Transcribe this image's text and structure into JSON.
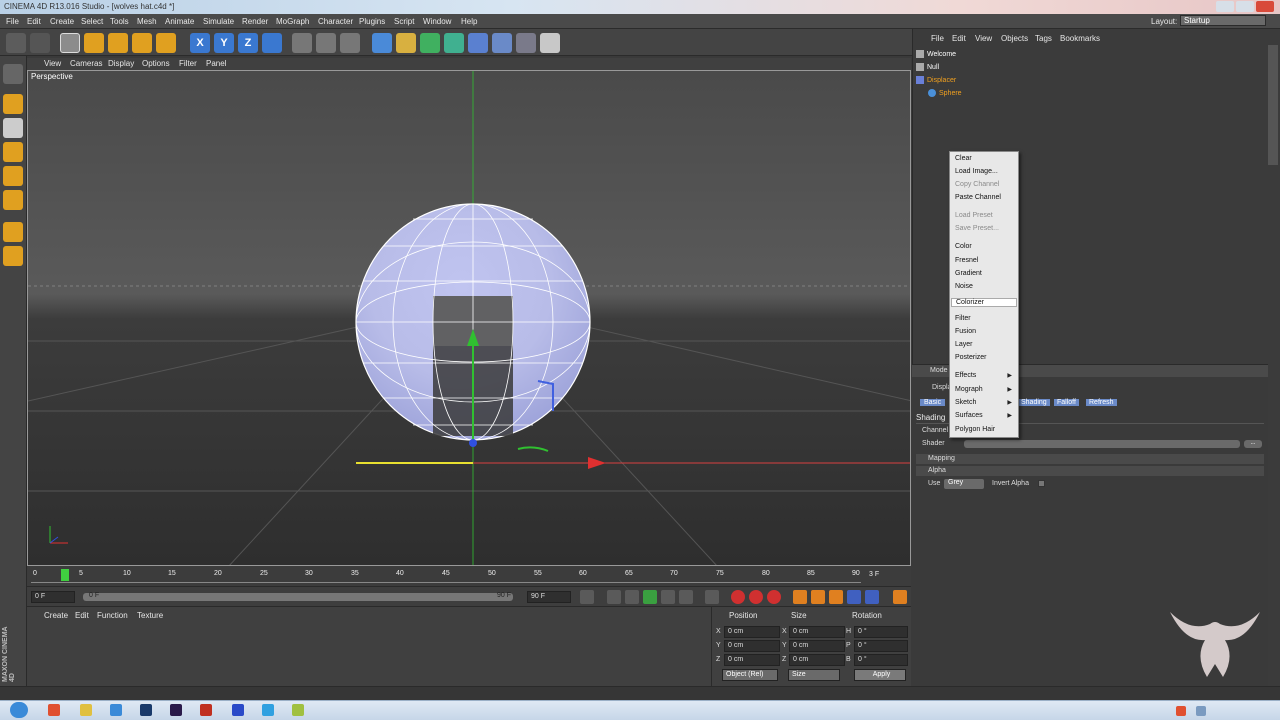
{
  "window": {
    "title": "CINEMA 4D R13.016 Studio - [wolves hat.c4d *]"
  },
  "menubar": [
    "File",
    "Edit",
    "Create",
    "Select",
    "Tools",
    "Mesh",
    "Animate",
    "Simulate",
    "Render",
    "MoGraph",
    "Character",
    "Plugins",
    "Script",
    "Window",
    "Help"
  ],
  "layout": {
    "label": "Layout:",
    "value": "Startup"
  },
  "viewport": {
    "menu": [
      "View",
      "Cameras",
      "Display",
      "Options",
      "Filter",
      "Panel"
    ],
    "camera_label": "Perspective"
  },
  "toolbar": {
    "axis_x": "X",
    "axis_y": "Y",
    "axis_z": "Z"
  },
  "timeline": {
    "ticks": [
      "0",
      "5",
      "10",
      "15",
      "20",
      "25",
      "30",
      "35",
      "40",
      "45",
      "50",
      "55",
      "60",
      "65",
      "70",
      "75",
      "80",
      "85",
      "90"
    ],
    "current_frame": "3 F",
    "start_field": "0 F",
    "range_start": "0 F",
    "range_end": "90 F",
    "end_field": "90 F"
  },
  "material_manager": {
    "menu": [
      "Create",
      "Edit",
      "Function",
      "Texture"
    ]
  },
  "coordinates": {
    "headers": {
      "position": "Position",
      "size": "Size",
      "rotation": "Rotation"
    },
    "rows": [
      {
        "axis": "X",
        "pos": "0 cm",
        "size_axis": "X",
        "size": "0 cm",
        "rot_axis": "H",
        "rot": "0 °"
      },
      {
        "axis": "Y",
        "pos": "0 cm",
        "size_axis": "Y",
        "size": "0 cm",
        "rot_axis": "P",
        "rot": "0 °"
      },
      {
        "axis": "Z",
        "pos": "0 cm",
        "size_axis": "Z",
        "size": "0 cm",
        "rot_axis": "B",
        "rot": "0 °"
      }
    ],
    "mode_select": "Object (Rel)",
    "size_select": "Size",
    "apply_button": "Apply"
  },
  "object_manager": {
    "menu": [
      "File",
      "Edit",
      "View",
      "Objects",
      "Tags",
      "Bookmarks"
    ],
    "objects": [
      {
        "name": "Welcome",
        "color": "#ffffff"
      },
      {
        "name": "Null",
        "color": "#ffffff"
      },
      {
        "name": "Displacer",
        "color": "#f0a020"
      },
      {
        "name": "Sphere",
        "color": "#f0a020"
      }
    ]
  },
  "attributes": {
    "mode_label": "Mode",
    "object_label": "Displacer",
    "tabs": [
      "Basic",
      "Shading",
      "Falloff",
      "Refresh"
    ],
    "section": "Shading",
    "channel_label": "Channel",
    "shader_label": "Shader",
    "shader_button": "...",
    "mapping": "Mapping",
    "alpha": "Alpha",
    "use_label": "Use",
    "use_value": "Grey",
    "invert_alpha": "Invert Alpha"
  },
  "context_menu": {
    "items": [
      {
        "label": "Clear",
        "disabled": false
      },
      {
        "label": "Load Image...",
        "disabled": false
      },
      {
        "label": "Copy Channel",
        "disabled": true
      },
      {
        "label": "Paste Channel",
        "disabled": false
      },
      {
        "label": "Load Preset",
        "disabled": true
      },
      {
        "label": "Save Preset...",
        "disabled": true
      },
      {
        "label": "Color",
        "disabled": false
      },
      {
        "label": "Fresnel",
        "disabled": false
      },
      {
        "label": "Gradient",
        "disabled": false
      },
      {
        "label": "Noise",
        "disabled": false
      },
      {
        "label": "Colorizer",
        "disabled": false,
        "highlighted": true
      },
      {
        "label": "Filter",
        "disabled": false
      },
      {
        "label": "Fusion",
        "disabled": false
      },
      {
        "label": "Layer",
        "disabled": false
      },
      {
        "label": "Posterizer",
        "disabled": false
      },
      {
        "label": "Effects",
        "submenu": true
      },
      {
        "label": "Mograph",
        "submenu": true
      },
      {
        "label": "Sketch",
        "submenu": true
      },
      {
        "label": "Surfaces",
        "submenu": true
      },
      {
        "label": "Polygon Hair",
        "disabled": false
      }
    ]
  },
  "branding": {
    "maxon": "MAXON CINEMA 4D"
  },
  "colors": {
    "accent": "#4a90d9",
    "highlight_orange": "#f0a020",
    "x_axis": "#e03030",
    "y_axis": "#30c030",
    "z_axis": "#3050e0"
  }
}
